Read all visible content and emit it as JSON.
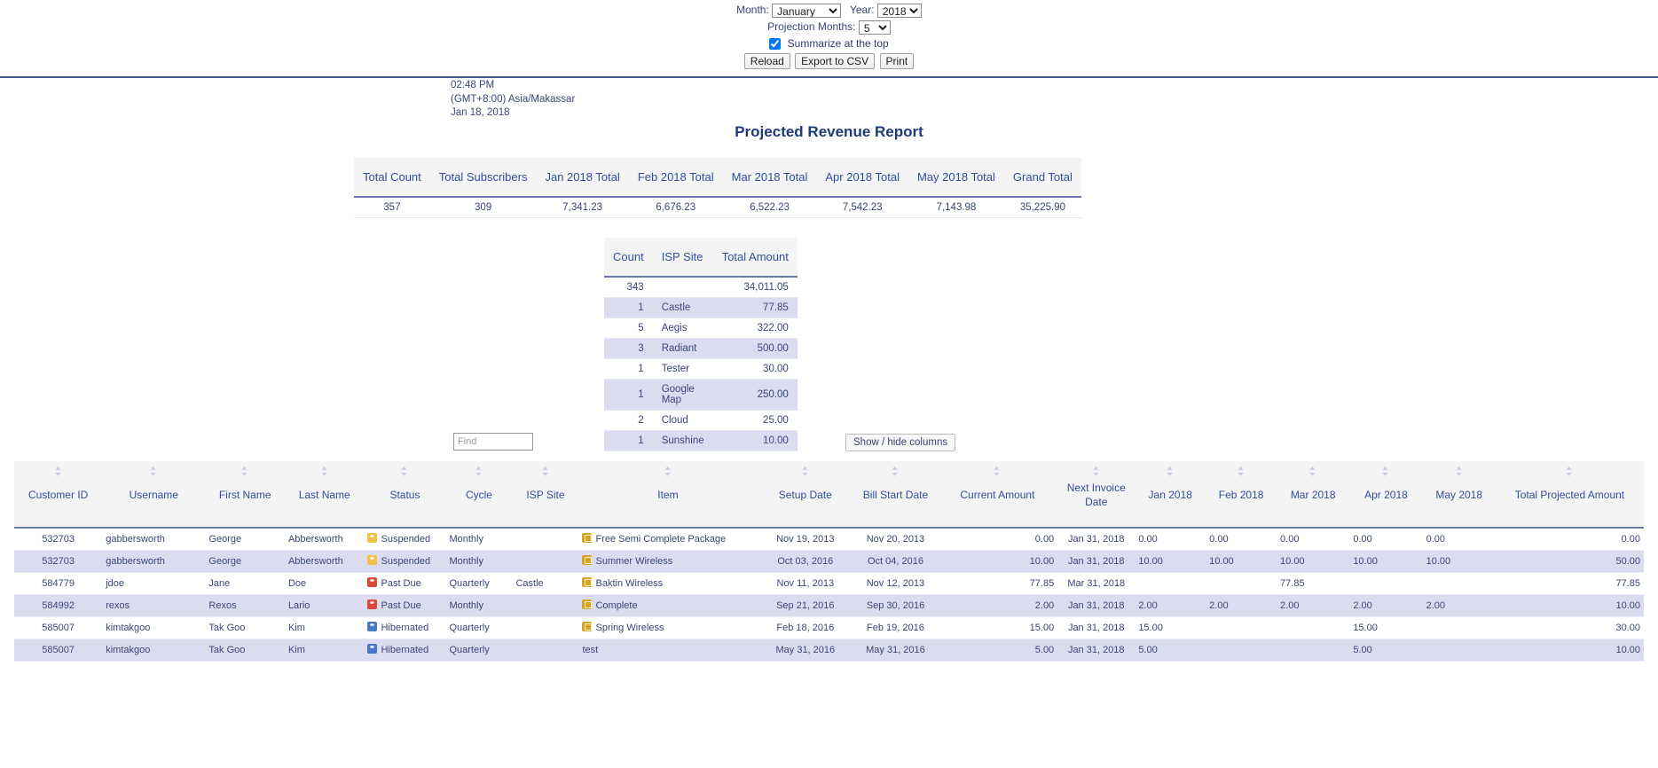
{
  "controls": {
    "month_label": "Month:",
    "month_value": "January",
    "month_options": [
      "January"
    ],
    "year_label": "Year:",
    "year_value": "2018",
    "year_options": [
      "2018"
    ],
    "projection_label": "Projection Months:",
    "projection_value": "5",
    "projection_options": [
      "5"
    ],
    "summarize_label": "Summarize at the top",
    "summarize_checked": true,
    "reload_label": "Reload",
    "export_label": "Export to CSV",
    "print_label": "Print"
  },
  "timestamp": {
    "time": "02:48 PM",
    "timezone": "(GMT+8:00) Asia/Makassar",
    "date": "Jan 18, 2018"
  },
  "report": {
    "title": "Projected Revenue Report"
  },
  "totals": {
    "headers": [
      "Total Count",
      "Total Subscribers",
      "Jan 2018 Total",
      "Feb 2018 Total",
      "Mar 2018 Total",
      "Apr 2018 Total",
      "May 2018 Total",
      "Grand Total"
    ],
    "values": [
      "357",
      "309",
      "7,341.23",
      "6,676.23",
      "6,522.23",
      "7,542.23",
      "7,143.98",
      "35,225.90"
    ]
  },
  "isp_summary": {
    "headers": [
      "Count",
      "ISP Site",
      "Total Amount"
    ],
    "rows": [
      {
        "count": "343",
        "site": "",
        "amount": "34,011.05"
      },
      {
        "count": "1",
        "site": "Castle",
        "amount": "77.85"
      },
      {
        "count": "5",
        "site": "Aegis",
        "amount": "322.00"
      },
      {
        "count": "3",
        "site": "Radiant",
        "amount": "500.00"
      },
      {
        "count": "1",
        "site": "Tester",
        "amount": "30.00"
      },
      {
        "count": "1",
        "site": "Google Map",
        "amount": "250.00"
      },
      {
        "count": "2",
        "site": "Cloud",
        "amount": "25.00"
      },
      {
        "count": "1",
        "site": "Sunshine",
        "amount": "10.00"
      }
    ]
  },
  "toolbar": {
    "find_placeholder": "Find",
    "find_value": "",
    "showhide_label": "Show / hide columns"
  },
  "grid": {
    "headers": [
      "Customer ID",
      "Username",
      "First Name",
      "Last Name",
      "Status",
      "Cycle",
      "ISP Site",
      "Item",
      "Setup Date",
      "Bill Start Date",
      "Current Amount",
      "Next Invoice Date",
      "Jan 2018",
      "Feb 2018",
      "Mar 2018",
      "Apr 2018",
      "May 2018",
      "Total Projected Amount"
    ],
    "rows": [
      {
        "customer_id": "532703",
        "username": "gabbersworth",
        "first_name": "George",
        "last_name": "Abbersworth",
        "status": "Suspended",
        "status_icon": "suspended",
        "cycle": "Monthly",
        "isp_site": "",
        "item": "Free Semi Complete Package",
        "setup_date": "Nov 19, 2013",
        "bill_start_date": "Nov 20, 2013",
        "current_amount": "0.00",
        "next_invoice_date": "Jan 31, 2018",
        "jan": "0.00",
        "feb": "0.00",
        "mar": "0.00",
        "apr": "0.00",
        "may": "0.00",
        "total": "0.00"
      },
      {
        "customer_id": "532703",
        "username": "gabbersworth",
        "first_name": "George",
        "last_name": "Abbersworth",
        "status": "Suspended",
        "status_icon": "suspended",
        "cycle": "Monthly",
        "isp_site": "",
        "item": "Summer Wireless",
        "setup_date": "Oct 03, 2016",
        "bill_start_date": "Oct 04, 2016",
        "current_amount": "10.00",
        "next_invoice_date": "Jan 31, 2018",
        "jan": "10.00",
        "feb": "10.00",
        "mar": "10.00",
        "apr": "10.00",
        "may": "10.00",
        "total": "50.00"
      },
      {
        "customer_id": "584779",
        "username": "jdoe",
        "first_name": "Jane",
        "last_name": "Doe",
        "status": "Past Due",
        "status_icon": "pastdue",
        "cycle": "Quarterly",
        "isp_site": "Castle",
        "item": "Baktin Wireless",
        "setup_date": "Nov 11, 2013",
        "bill_start_date": "Nov 12, 2013",
        "current_amount": "77.85",
        "next_invoice_date": "Mar 31, 2018",
        "jan": "",
        "feb": "",
        "mar": "77.85",
        "apr": "",
        "may": "",
        "total": "77.85"
      },
      {
        "customer_id": "584992",
        "username": "rexos",
        "first_name": "Rexos",
        "last_name": "Lario",
        "status": "Past Due",
        "status_icon": "pastdue",
        "cycle": "Monthly",
        "isp_site": "",
        "item": "Complete",
        "setup_date": "Sep 21, 2016",
        "bill_start_date": "Sep 30, 2016",
        "current_amount": "2.00",
        "next_invoice_date": "Jan 31, 2018",
        "jan": "2.00",
        "feb": "2.00",
        "mar": "2.00",
        "apr": "2.00",
        "may": "2.00",
        "total": "10.00"
      },
      {
        "customer_id": "585007",
        "username": "kimtakgoo",
        "first_name": "Tak Goo",
        "last_name": "Kim",
        "status": "Hibernated",
        "status_icon": "hibernated",
        "cycle": "Quarterly",
        "isp_site": "",
        "item": "Spring Wireless",
        "setup_date": "Feb 18, 2016",
        "bill_start_date": "Feb 19, 2016",
        "current_amount": "15.00",
        "next_invoice_date": "Jan 31, 2018",
        "jan": "15.00",
        "feb": "",
        "mar": "",
        "apr": "15.00",
        "may": "",
        "total": "30.00"
      },
      {
        "customer_id": "585007",
        "username": "kimtakgoo",
        "first_name": "Tak Goo",
        "last_name": "Kim",
        "status": "Hibernated",
        "status_icon": "hibernated",
        "cycle": "Quarterly",
        "isp_site": "",
        "item": "test",
        "item_no_icon": true,
        "setup_date": "May 31, 2016",
        "bill_start_date": "May 31, 2016",
        "current_amount": "5.00",
        "next_invoice_date": "Jan 31, 2018",
        "jan": "5.00",
        "feb": "",
        "mar": "",
        "apr": "5.00",
        "may": "",
        "total": "10.00"
      }
    ]
  },
  "colors": {
    "accent": "#2f4e9e",
    "title": "#1f3a7a",
    "alt_row": "#dcdcf0",
    "header_bg": "#f4f4f4",
    "rule": "#6b7ba8",
    "status_suspended": "#f2c14a",
    "status_pastdue": "#d94a3d",
    "status_hibernated": "#4a77c4",
    "item_icon": "#d9a520"
  }
}
